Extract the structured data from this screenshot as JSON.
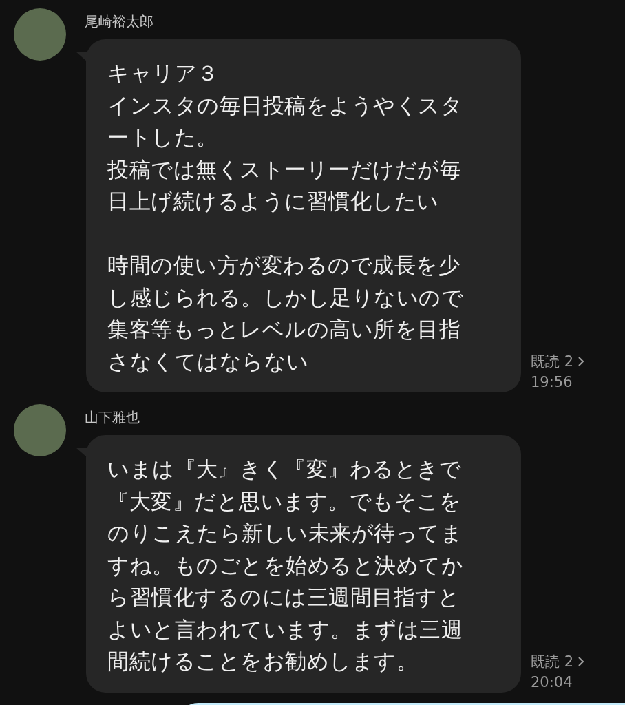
{
  "messages": [
    {
      "sender": "尾崎裕太郎",
      "paragraphs": [
        [
          "キャリア３",
          "インスタの毎日投稿をようやくスタ",
          "ートした。",
          "投稿では無くストーリーだけだが毎",
          "日上げ続けるように習慣化したい"
        ],
        [
          "時間の使い方が変わるので成長を少",
          "し感じられる。しかし足りないので",
          "集客等もっとレベルの高い所を目指",
          "さなくてはならない"
        ]
      ],
      "read": "既読 2",
      "time": "19:56"
    },
    {
      "sender": "山下雅也",
      "paragraphs": [
        [
          "いまは『大』きく『変』わるときで",
          "『大変』だと思います。でもそこを",
          "のりこえたら新しい未来が待ってま",
          "すね。ものごとを始めると決めてか",
          "ら習慣化するのには三週間目指すと",
          "よいと言われています。まずは三週",
          "間続けることをお勧めします。"
        ]
      ],
      "read": "既読 2",
      "time": "20:04"
    }
  ]
}
